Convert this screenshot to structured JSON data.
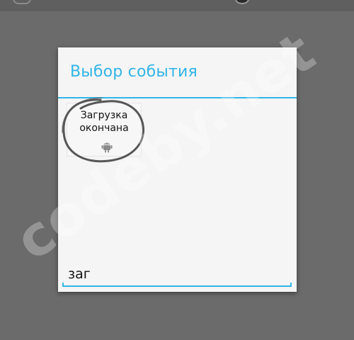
{
  "dialog": {
    "title": "Выбор события",
    "events": [
      {
        "label": "Загрузка оконча­на",
        "icon": "android-icon"
      }
    ]
  },
  "search": {
    "value": "заг"
  },
  "watermark": {
    "text": "codeby.net"
  },
  "colors": {
    "accent": "#33b5e5",
    "dialog_bg": "#f5f5f5",
    "overlay": "#6b6b6b"
  }
}
